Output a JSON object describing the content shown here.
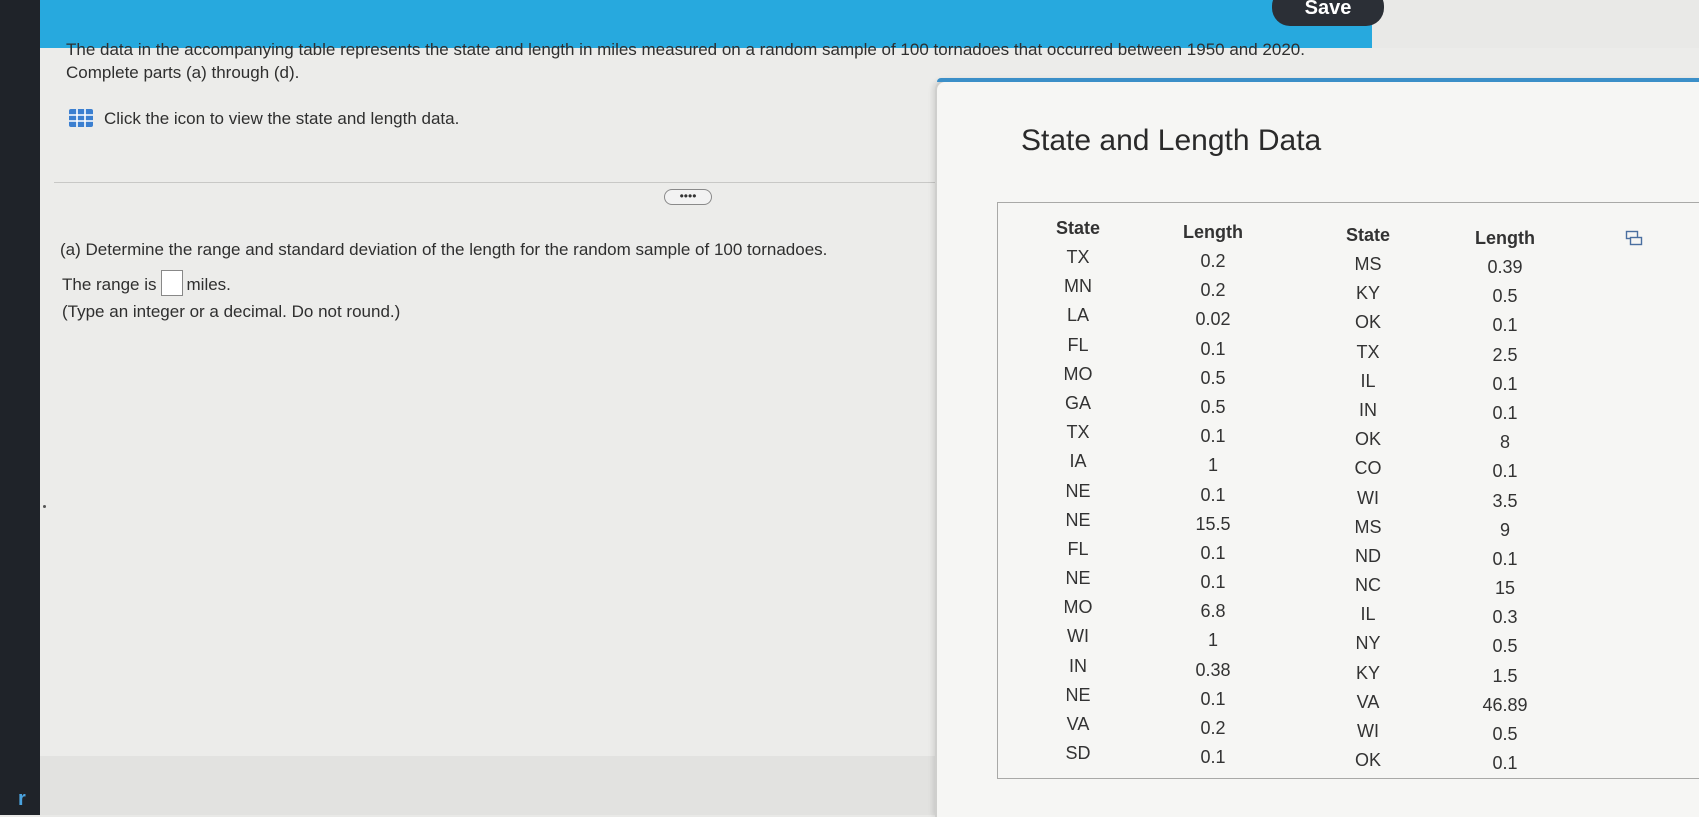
{
  "toolbar": {
    "save_label": "Save"
  },
  "question": {
    "intro": "The data in the accompanying table represents the state and length in miles measured on a random sample of 100 tornadoes that occurred between 1950 and 2020. Complete parts (a) through (d).",
    "data_link_text": "Click the icon to view the state and length data.",
    "more_label": "••••",
    "part_a": "(a) Determine the range and standard deviation of the length for the random sample of 100 tornadoes.",
    "range_prefix": "The range is",
    "range_value": "",
    "range_suffix": "miles.",
    "hint": "(Type an integer or a decimal. Do not round.)"
  },
  "popup": {
    "title": "State and Length Data",
    "headers": {
      "state": "State",
      "length": "Length"
    },
    "left_states": [
      "TX",
      "MN",
      "LA",
      "FL",
      "MO",
      "GA",
      "TX",
      "IA",
      "NE",
      "NE",
      "FL",
      "NE",
      "MO",
      "WI",
      "IN",
      "NE",
      "VA",
      "SD"
    ],
    "left_lengths": [
      "0.2",
      "0.2",
      "0.02",
      "0.1",
      "0.5",
      "0.5",
      "0.1",
      "1",
      "0.1",
      "15.5",
      "0.1",
      "0.1",
      "6.8",
      "1",
      "0.38",
      "0.1",
      "0.2",
      "0.1"
    ],
    "right_states": [
      "MS",
      "KY",
      "OK",
      "TX",
      "IL",
      "IN",
      "OK",
      "CO",
      "WI",
      "MS",
      "ND",
      "NC",
      "IL",
      "NY",
      "KY",
      "VA",
      "WI",
      "OK"
    ],
    "right_lengths": [
      "0.39",
      "0.5",
      "0.1",
      "2.5",
      "0.1",
      "0.1",
      "8",
      "0.1",
      "3.5",
      "9",
      "0.1",
      "15",
      "0.3",
      "0.5",
      "1.5",
      "46.89",
      "0.5",
      "0.1"
    ]
  },
  "icons": {
    "data_table": "grid-table-icon",
    "copy": "copy-icon",
    "more": "ellipsis-icon"
  },
  "colors": {
    "banner": "#27a9de",
    "save_button": "#2b2f36",
    "table_icon": "#3b7fd0"
  }
}
